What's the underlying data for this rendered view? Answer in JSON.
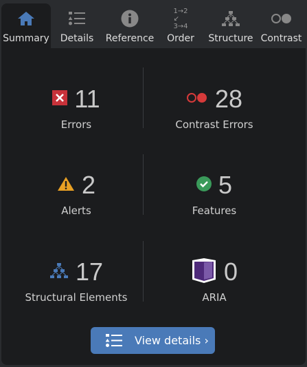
{
  "tabs": [
    {
      "label": "Summary",
      "icon": "home-icon",
      "active": true
    },
    {
      "label": "Details",
      "icon": "list-icon"
    },
    {
      "label": "Reference",
      "icon": "info-icon"
    },
    {
      "label": "Order",
      "icon": "order-icon"
    },
    {
      "label": "Structure",
      "icon": "structure-icon"
    },
    {
      "label": "Contrast",
      "icon": "contrast-icon"
    }
  ],
  "summary": [
    {
      "count": "11",
      "label": "Errors",
      "icon": "error-icon",
      "color": "#c8323a"
    },
    {
      "count": "28",
      "label": "Contrast Errors",
      "icon": "contrast-error-icon",
      "color": "#d63a3a"
    },
    {
      "count": "2",
      "label": "Alerts",
      "icon": "alert-icon",
      "color": "#e8a024"
    },
    {
      "count": "5",
      "label": "Features",
      "icon": "feature-icon",
      "color": "#3a9a5a"
    },
    {
      "count": "17",
      "label": "Structural Elements",
      "icon": "structure-icon",
      "color": "#4a7ab8"
    },
    {
      "count": "0",
      "label": "ARIA",
      "icon": "aria-icon",
      "color": "#5b2d86"
    }
  ],
  "button": {
    "label": "View details ›",
    "color": "#4a7ab8"
  }
}
